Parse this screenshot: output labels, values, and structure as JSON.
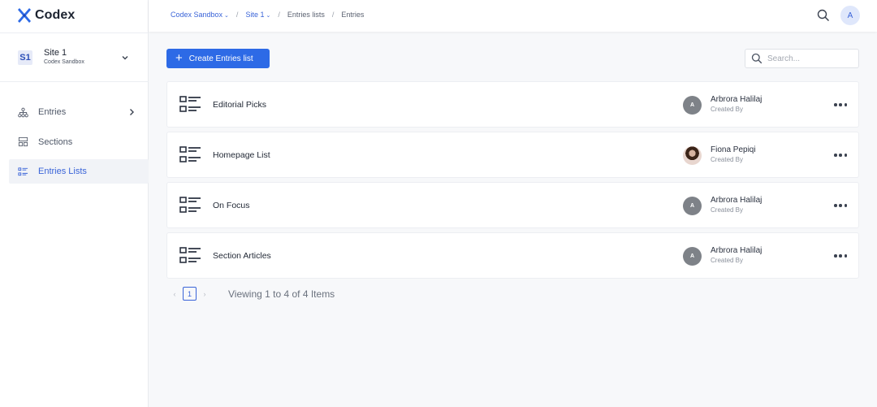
{
  "app": {
    "name": "Codex"
  },
  "site": {
    "badge": "S1",
    "name": "Site 1",
    "org": "Codex Sandbox"
  },
  "sidebar": {
    "items": [
      {
        "label": "Entries",
        "icon": "hierarchy-icon",
        "active": false,
        "has_arrow": true
      },
      {
        "label": "Sections",
        "icon": "layout-icon",
        "active": false,
        "has_arrow": false
      },
      {
        "label": "Entries Lists",
        "icon": "list-icon",
        "active": true,
        "has_arrow": false
      }
    ]
  },
  "breadcrumb": {
    "items": [
      {
        "label": "Codex Sandbox",
        "dropdown": true
      },
      {
        "label": "Site 1",
        "dropdown": true
      },
      {
        "label": "Entries lists",
        "dropdown": false
      },
      {
        "label": "Entries",
        "dropdown": false
      }
    ],
    "separator": "/"
  },
  "user": {
    "initial": "A"
  },
  "toolbar": {
    "create_label": "Create Entries list",
    "search_placeholder": "Search..."
  },
  "lists": [
    {
      "title": "Editorial Picks",
      "creator": "Arbrora Halilaj",
      "role": "Created By",
      "avatar": "A",
      "photo": false
    },
    {
      "title": "Homepage List",
      "creator": "Fiona Pepiqi",
      "role": "Created By",
      "avatar": "",
      "photo": true
    },
    {
      "title": "On Focus",
      "creator": "Arbrora Halilaj",
      "role": "Created By",
      "avatar": "A",
      "photo": false
    },
    {
      "title": "Section Articles",
      "creator": "Arbrora Halilaj",
      "role": "Created By",
      "avatar": "A",
      "photo": false
    }
  ],
  "pagination": {
    "prev": "‹",
    "next": "›",
    "current": "1",
    "info": "Viewing 1 to 4 of 4 Items"
  },
  "colors": {
    "accent": "#2d6ae6",
    "active_nav": "#3a64d8",
    "avatar_gray": "#7e8288"
  }
}
